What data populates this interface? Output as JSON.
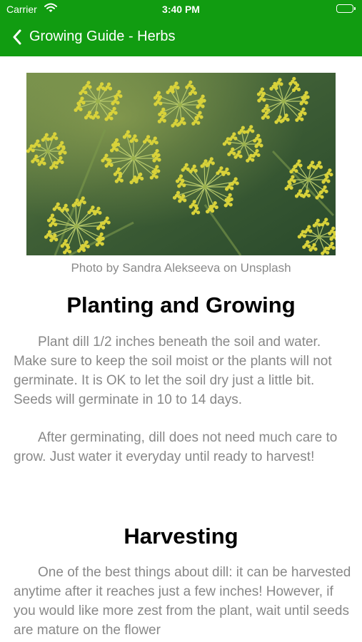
{
  "status_bar": {
    "carrier": "Carrier",
    "time": "3:40 PM"
  },
  "nav": {
    "title": "Growing Guide - Herbs"
  },
  "photo": {
    "caption": "Photo by Sandra Alekseeva on Unsplash"
  },
  "sections": [
    {
      "title": "Planting and Growing",
      "paragraphs": [
        "Plant dill 1/2 inches beneath the soil and water. Make sure to keep the soil moist or the plants will not germinate. It is OK to let the soil dry just a little bit. Seeds will germinate in 10 to 14 days.",
        "After germinating, dill does not need much care to grow. Just water it everyday until ready to harvest!"
      ]
    },
    {
      "title": "Harvesting",
      "paragraphs": [
        "One of the best things about dill: it can be harvested anytime after it reaches just a few inches! However, if you would like more zest from the plant, wait until seeds are mature on the flower"
      ]
    }
  ],
  "colors": {
    "nav_bar": "#119c11",
    "body_text": "#888888",
    "caption": "#8a8a8a"
  }
}
